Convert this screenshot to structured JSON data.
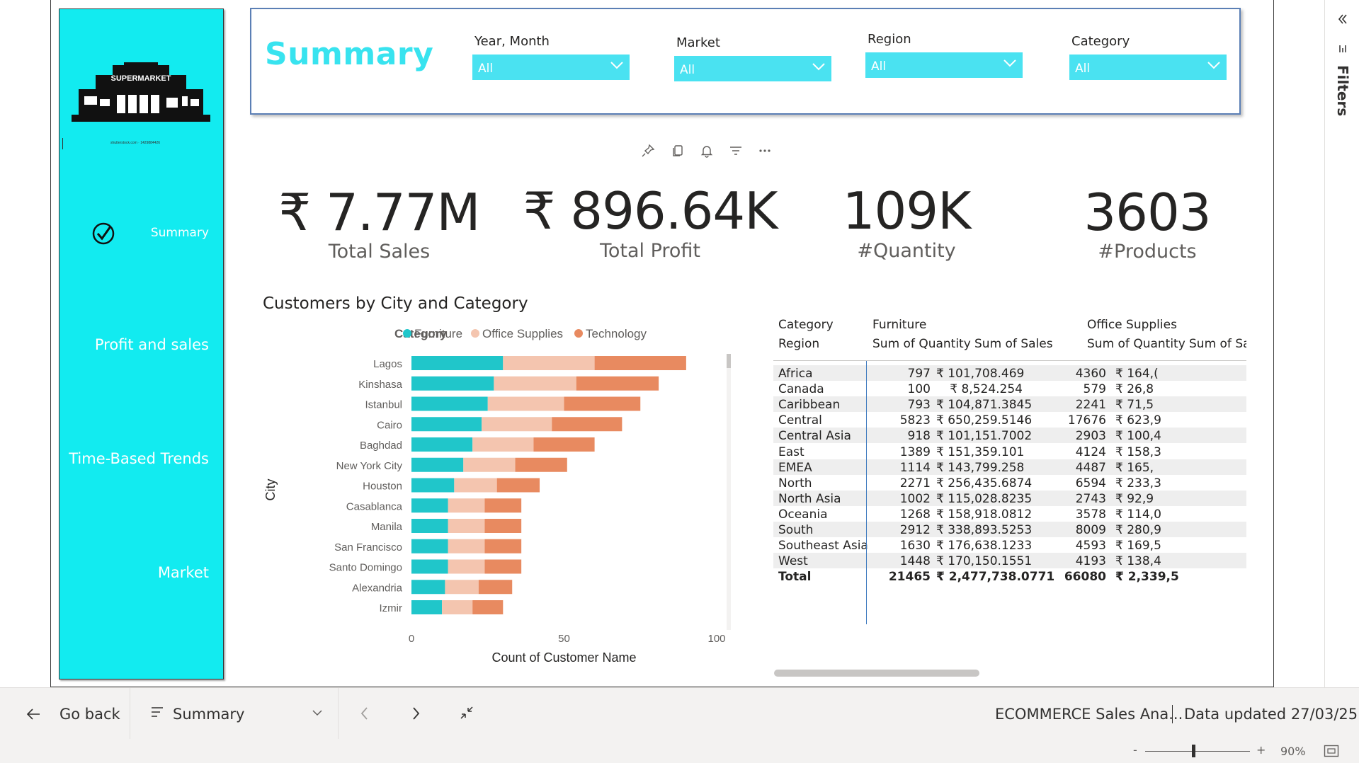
{
  "sidebar": {
    "logo_sign": "SUPERMARKET",
    "logo_caption": "shutterstock.com · 1429884426",
    "items": [
      {
        "label": "Summary",
        "active": true
      },
      {
        "label": "Profit and sales"
      },
      {
        "label": "Time-Based Trends"
      },
      {
        "label": "Market"
      }
    ]
  },
  "header": {
    "title": "Summary",
    "slicers": [
      {
        "label": "Year, Month",
        "value": "All"
      },
      {
        "label": "Market",
        "value": "All"
      },
      {
        "label": "Region",
        "value": "All"
      },
      {
        "label": "Category",
        "value": "All"
      }
    ]
  },
  "visual_header_icons": [
    "pin-icon",
    "copy-icon",
    "bell-icon",
    "filter-icon",
    "more-icon"
  ],
  "kpis": [
    {
      "value": "₹ 7.77M",
      "label": "Total Sales"
    },
    {
      "value": "₹ 896.64K",
      "label": "Total Profit"
    },
    {
      "value": "109K",
      "label": "#Quantity"
    },
    {
      "value": "3603",
      "label": "#Products"
    }
  ],
  "chart_data": {
    "type": "bar",
    "orientation": "horizontal",
    "stacked": true,
    "title": "Customers by City and Category",
    "legend_title": "Category",
    "xlabel": "Count of Customer Name",
    "ylabel": "City",
    "xlim": [
      0,
      100
    ],
    "xticks": [
      "0",
      "50",
      "100"
    ],
    "categories": [
      "Lagos",
      "Kinshasa",
      "Istanbul",
      "Cairo",
      "Baghdad",
      "New York City",
      "Houston",
      "Casablanca",
      "Manila",
      "San Francisco",
      "Santo Domingo",
      "Alexandria",
      "Izmir"
    ],
    "series": [
      {
        "name": "Furniture",
        "color": "#20c6ca",
        "values": [
          30,
          27,
          25,
          23,
          20,
          17,
          14,
          12,
          12,
          12,
          12,
          11,
          10
        ]
      },
      {
        "name": "Office Supplies",
        "color": "#f4c5af",
        "values": [
          30,
          27,
          25,
          23,
          20,
          17,
          14,
          12,
          12,
          12,
          12,
          11,
          10
        ]
      },
      {
        "name": "Technology",
        "color": "#e88a60",
        "values": [
          30,
          27,
          25,
          23,
          20,
          17,
          14,
          12,
          12,
          12,
          12,
          11,
          10
        ]
      }
    ]
  },
  "matrix": {
    "corner_labels": [
      "Category",
      "Region"
    ],
    "column_groups": [
      "Furniture",
      "Office Supplies"
    ],
    "measure_labels": [
      "Sum of Quantity",
      "Sum of Sales",
      "Sum of Quantity",
      "Sum of Sa"
    ],
    "rows": [
      {
        "region": "Africa",
        "c1": "797",
        "c2": "₹ 101,708.469",
        "c3": "4360",
        "c4": "₹ 164,("
      },
      {
        "region": "Canada",
        "c1": "100",
        "c2": "₹ 8,524.254",
        "c3": "579",
        "c4": "₹ 26,8"
      },
      {
        "region": "Caribbean",
        "c1": "793",
        "c2": "₹ 104,871.3845",
        "c3": "2241",
        "c4": "₹ 71,5"
      },
      {
        "region": "Central",
        "c1": "5823",
        "c2": "₹ 650,259.5146",
        "c3": "17676",
        "c4": "₹ 623,9"
      },
      {
        "region": "Central Asia",
        "c1": "918",
        "c2": "₹ 101,151.7002",
        "c3": "2903",
        "c4": "₹ 100,4"
      },
      {
        "region": "East",
        "c1": "1389",
        "c2": "₹ 151,359.101",
        "c3": "4124",
        "c4": "₹ 158,3"
      },
      {
        "region": "EMEA",
        "c1": "1114",
        "c2": "₹ 143,799.258",
        "c3": "4487",
        "c4": "₹ 165,"
      },
      {
        "region": "North",
        "c1": "2271",
        "c2": "₹ 256,435.6874",
        "c3": "6594",
        "c4": "₹ 233,3"
      },
      {
        "region": "North Asia",
        "c1": "1002",
        "c2": "₹ 115,028.8235",
        "c3": "2743",
        "c4": "₹ 92,9"
      },
      {
        "region": "Oceania",
        "c1": "1268",
        "c2": "₹ 158,918.0812",
        "c3": "3578",
        "c4": "₹ 114,0"
      },
      {
        "region": "South",
        "c1": "2912",
        "c2": "₹ 338,893.5253",
        "c3": "8009",
        "c4": "₹ 280,9"
      },
      {
        "region": "Southeast Asia",
        "c1": "1630",
        "c2": "₹ 176,638.1233",
        "c3": "4593",
        "c4": "₹ 169,5"
      },
      {
        "region": "West",
        "c1": "1448",
        "c2": "₹ 170,150.1551",
        "c3": "4193",
        "c4": "₹ 138,4"
      }
    ],
    "total": {
      "region": "Total",
      "c1": "21465",
      "c2": "₹ 2,477,738.0771",
      "c3": "66080",
      "c4": "₹ 2,339,5"
    }
  },
  "filters_pane": {
    "label": "Filters"
  },
  "bottom_bar": {
    "back_label": "Go back",
    "page_selector": "Summary",
    "report_name": "ECOMMERCE Sales Ana...",
    "data_updated": "Data updated 27/03/25"
  },
  "status_bar": {
    "zoom_minus": "-",
    "zoom_plus": "+",
    "zoom_level": "90%"
  },
  "colors": {
    "accent_cyan": "#12ebf0",
    "slicer_fill": "#4ae2f1",
    "title_cyan": "#38e3ef"
  }
}
